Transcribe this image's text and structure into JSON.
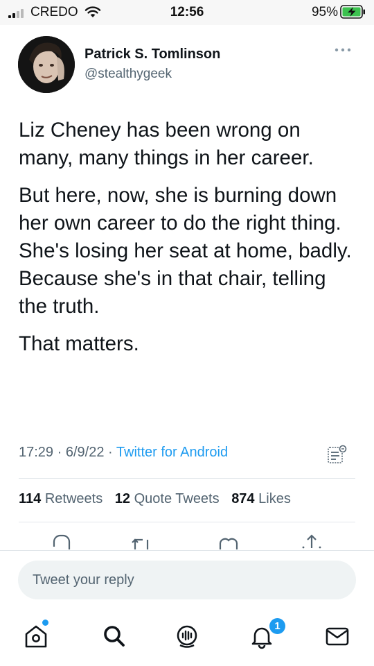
{
  "status_bar": {
    "carrier": "CREDO",
    "time": "12:56",
    "battery": "95%",
    "battery_charging": true
  },
  "author": {
    "name": "Patrick S. Tomlinson",
    "handle": "@stealthygeek"
  },
  "tweet": {
    "paragraphs": [
      "Liz Cheney has been wrong on many, many things in her career.",
      "But here, now, she is burning down her own career to do the right thing. She's losing her seat at home, badly. Because she's in that chair, telling the truth.",
      "That matters."
    ],
    "time": "17:29",
    "date": "6/9/22",
    "separator": "·",
    "source": "Twitter for Android"
  },
  "stats": {
    "retweets_count": "114",
    "retweets_label": "Retweets",
    "quotes_count": "12",
    "quotes_label": "Quote Tweets",
    "likes_count": "874",
    "likes_label": "Likes"
  },
  "reply": {
    "placeholder": "Tweet your reply"
  },
  "icons": {
    "more": "more-horizontal-icon",
    "analytics": "analytics-icon",
    "reply": "reply-icon",
    "retweet": "retweet-icon",
    "like": "like-icon",
    "share": "share-icon",
    "home": "home-icon",
    "search": "search-icon",
    "spaces": "spaces-icon",
    "notifications": "notifications-icon",
    "messages": "messages-icon"
  },
  "tab_bar": {
    "notifications_badge": "1"
  },
  "colors": {
    "accent": "#1d9bf0",
    "text": "#0f1419",
    "secondary": "#536471"
  }
}
